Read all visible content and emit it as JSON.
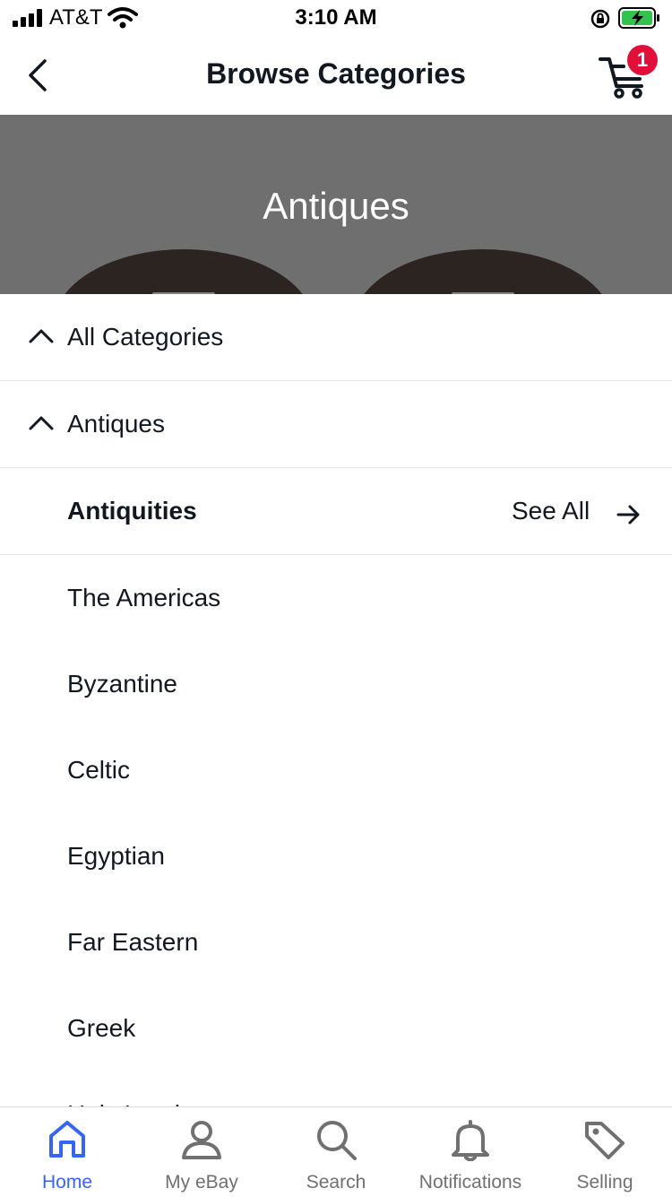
{
  "status_bar": {
    "carrier": "AT&T",
    "time": "3:10 AM"
  },
  "header": {
    "title": "Browse Categories",
    "cart_count": "1"
  },
  "hero": {
    "title": "Antiques"
  },
  "breadcrumbs": [
    {
      "label": "All Categories"
    },
    {
      "label": "Antiques"
    }
  ],
  "current_category": {
    "label": "Antiquities",
    "see_all": "See All"
  },
  "subcategories": [
    "The Americas",
    "Byzantine",
    "Celtic",
    "Egyptian",
    "Far Eastern",
    "Greek",
    "Holy Land"
  ],
  "tabs": [
    {
      "label": "Home",
      "icon": "home-icon",
      "active": true
    },
    {
      "label": "My eBay",
      "icon": "person-icon",
      "active": false
    },
    {
      "label": "Search",
      "icon": "search-icon",
      "active": false
    },
    {
      "label": "Notifications",
      "icon": "bell-icon",
      "active": false
    },
    {
      "label": "Selling",
      "icon": "tag-icon",
      "active": false
    }
  ],
  "colors": {
    "accent": "#3665f3",
    "badge": "#e0103a",
    "hero_bg": "#6f6f6f"
  }
}
